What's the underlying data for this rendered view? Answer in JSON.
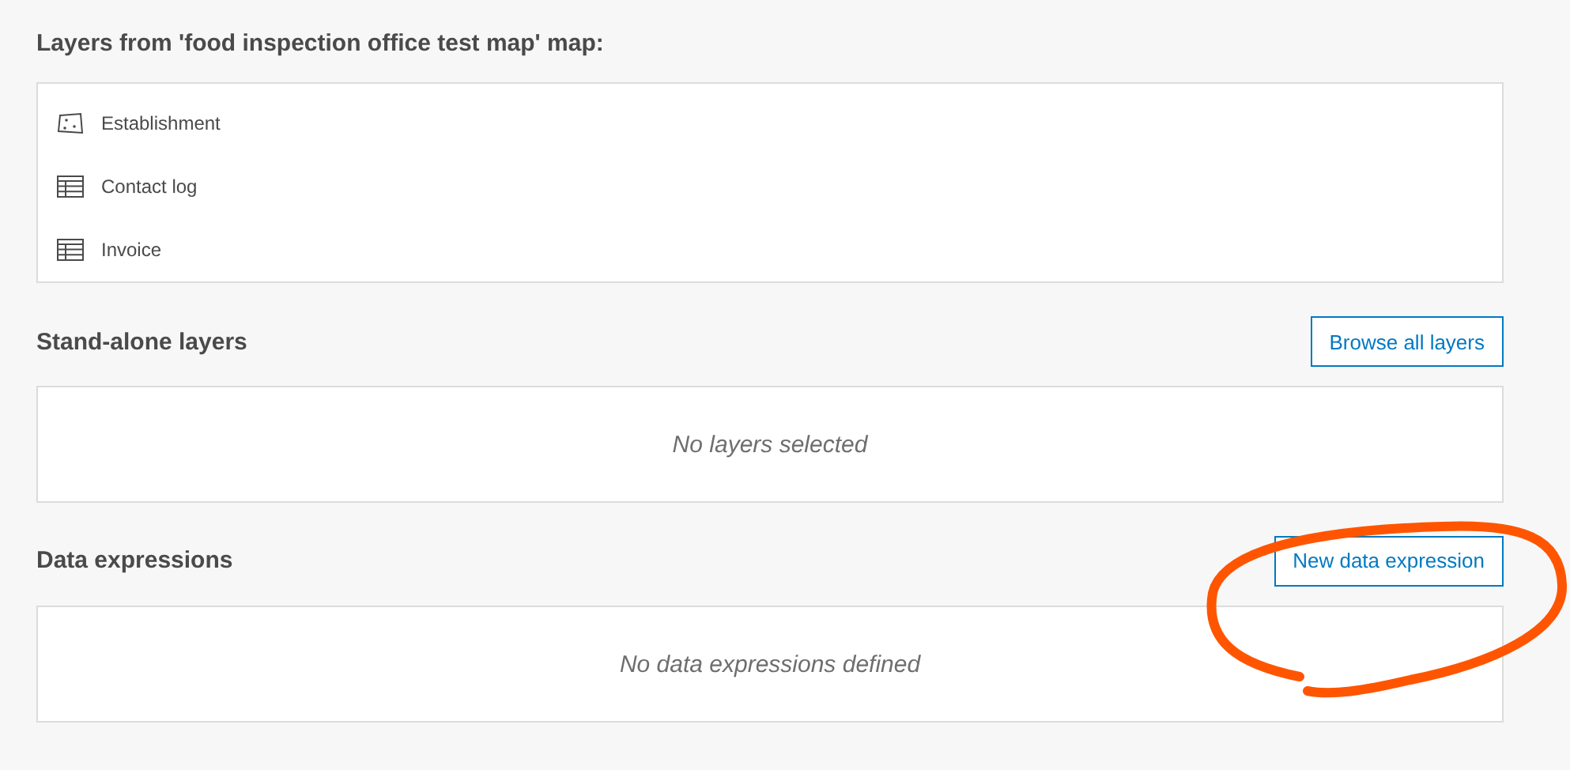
{
  "map_layers": {
    "title": "Layers from 'food inspection office test map' map:",
    "items": [
      {
        "kind": "feature",
        "label": "Establishment"
      },
      {
        "kind": "table",
        "label": "Contact log"
      },
      {
        "kind": "table",
        "label": "Invoice"
      }
    ]
  },
  "standalone_layers": {
    "title": "Stand-alone layers",
    "button": "Browse all layers",
    "empty_message": "No layers selected"
  },
  "data_expressions": {
    "title": "Data expressions",
    "button": "New data expression",
    "empty_message": "No data expressions defined"
  }
}
